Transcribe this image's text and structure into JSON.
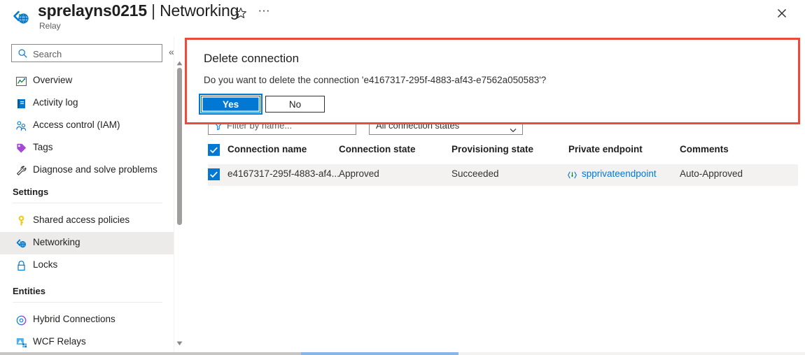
{
  "header": {
    "resource_name": "sprelayns0215",
    "separator": "|",
    "blade_name": "Networking",
    "subtitle": "Relay",
    "resource_icon": "relay-icon",
    "favorite_icon": "star-outline-icon",
    "more_menu_label": "···",
    "close_icon": "close-icon"
  },
  "sidebar": {
    "search": {
      "placeholder": "Search",
      "value": "",
      "icon": "search-icon"
    },
    "collapse_label": "«",
    "items": [
      {
        "label": "Overview",
        "icon": "overview-icon",
        "selected": false
      },
      {
        "label": "Activity log",
        "icon": "activity-log-icon",
        "selected": false
      },
      {
        "label": "Access control (IAM)",
        "icon": "access-control-icon",
        "selected": false
      },
      {
        "label": "Tags",
        "icon": "tags-icon",
        "selected": false
      },
      {
        "label": "Diagnose and solve problems",
        "icon": "diagnose-icon",
        "selected": false
      },
      {
        "label": "Shared access policies",
        "icon": "key-icon",
        "selected": false
      },
      {
        "label": "Networking",
        "icon": "networking-icon",
        "selected": true
      },
      {
        "label": "Locks",
        "icon": "lock-icon",
        "selected": false
      },
      {
        "label": "Hybrid Connections",
        "icon": "hybrid-connections-icon",
        "selected": false
      },
      {
        "label": "WCF Relays",
        "icon": "wcf-relays-icon",
        "selected": false
      }
    ],
    "sections": [
      {
        "label": "Settings"
      },
      {
        "label": "Entities"
      }
    ]
  },
  "filters": {
    "name_filter_placeholder": "Filter by name...",
    "name_filter_icon": "filter-icon",
    "state_filter_value": "All connection states",
    "state_filter_icon": "chevron-down-icon"
  },
  "table": {
    "columns": [
      "Connection name",
      "Connection state",
      "Provisioning state",
      "Private endpoint",
      "Comments"
    ],
    "header_checkbox_checked": true,
    "rows": [
      {
        "checked": true,
        "connection_name": "e4167317-295f-4883-af4...",
        "connection_state": "Approved",
        "provisioning_state": "Succeeded",
        "private_endpoint": "spprivateendpoint",
        "private_endpoint_icon": "private-endpoint-icon",
        "comments": "Auto-Approved"
      }
    ]
  },
  "dialog": {
    "title": "Delete connection",
    "message": "Do you want to delete the connection 'e4167317-295f-4883-af43-e7562a050583'?",
    "yes_label": "Yes",
    "no_label": "No",
    "highlight_color": "#e74c3c"
  },
  "colors": {
    "accent": "#0078d4",
    "selected_row": "#f3f2f1",
    "selected_nav": "#edebe9",
    "link": "#0078d4"
  }
}
